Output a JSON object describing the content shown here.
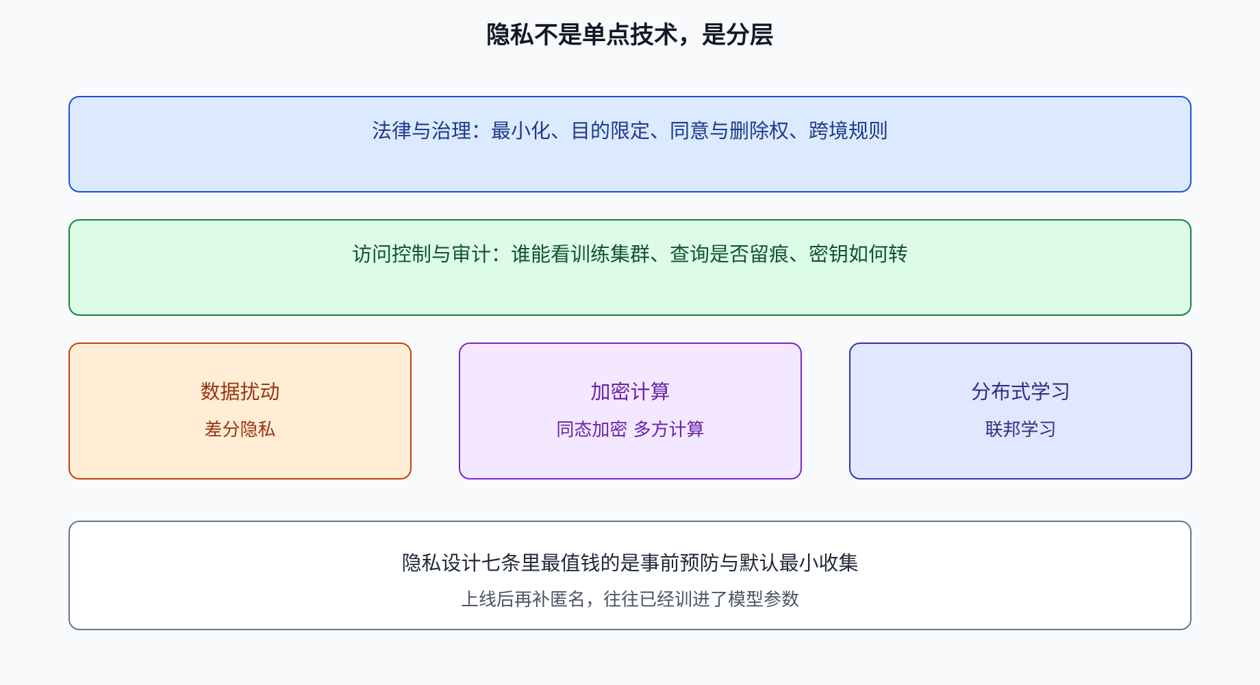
{
  "title": "隐私不是单点技术，是分层",
  "layers": [
    {
      "text": "法律与治理：最小化、目的限定、同意与删除权、跨境规则",
      "colors": {
        "fill": "#dbeafe",
        "border": "#1d4ed8",
        "text": "#1e3a8a"
      }
    },
    {
      "text": "访问控制与审计：谁能看训练集群、查询是否留痕、密钥如何转",
      "colors": {
        "fill": "#dcfce7",
        "border": "#15803d",
        "text": "#14532d"
      }
    }
  ],
  "techniques": [
    {
      "heading": "数据扰动",
      "sub": "差分隐私",
      "colors": {
        "fill": "#ffedd5",
        "border": "#c2410c",
        "text": "#9a3412"
      }
    },
    {
      "heading": "加密计算",
      "sub": "同态加密 多方计算",
      "colors": {
        "fill": "#f3e8ff",
        "border": "#7e22ce",
        "text": "#6b21a8"
      }
    },
    {
      "heading": "分布式学习",
      "sub": "联邦学习",
      "colors": {
        "fill": "#e0e7ff",
        "border": "#3730a3",
        "text": "#312e81"
      }
    }
  ],
  "note": {
    "main": "隐私设计七条里最值钱的是事前预防与默认最小收集",
    "sub": "上线后再补匿名，往往已经训进了模型参数"
  }
}
